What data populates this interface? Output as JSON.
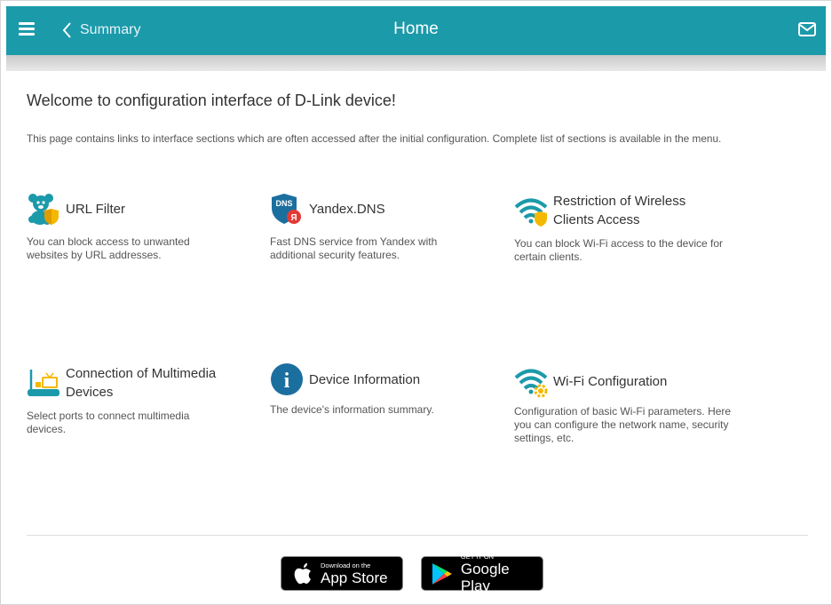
{
  "header": {
    "back_label": "Summary",
    "title": "Home",
    "accent_color": "#1b9aaa"
  },
  "welcome": "Welcome to configuration interface of D-Link device!",
  "intro": "This page contains links to interface sections which are often accessed after the initial configuration. Complete list of sections is available in the menu.",
  "cards": [
    {
      "title": "URL Filter",
      "desc": "You can block access to unwanted websites by URL addresses.",
      "icon": "teddy-bear-shield-icon"
    },
    {
      "title": "Yandex.DNS",
      "desc": "Fast DNS service from Yandex with additional security features.",
      "icon": "dns-shield-icon",
      "icon_text": "DNS",
      "icon_badge": "Я"
    },
    {
      "title": "Restriction of Wireless Clients Access",
      "desc": "You can block Wi-Fi access to the device for certain clients.",
      "icon": "wifi-shield-icon"
    },
    {
      "title": "Connection of Multimedia Devices",
      "desc": "Select ports to connect multimedia devices.",
      "icon": "router-tv-icon"
    },
    {
      "title": "Device Information",
      "desc": "The device's information summary.",
      "icon": "info-icon",
      "icon_text": "i"
    },
    {
      "title": "Wi-Fi Configuration",
      "desc": "Configuration of basic Wi-Fi parameters. Here you can configure the network name, security settings, etc.",
      "icon": "wifi-gear-icon"
    }
  ],
  "badges": {
    "appstore_small": "Download on the",
    "appstore_big": "App Store",
    "googleplay_small": "GET IT ON",
    "googleplay_big": "Google Play"
  }
}
